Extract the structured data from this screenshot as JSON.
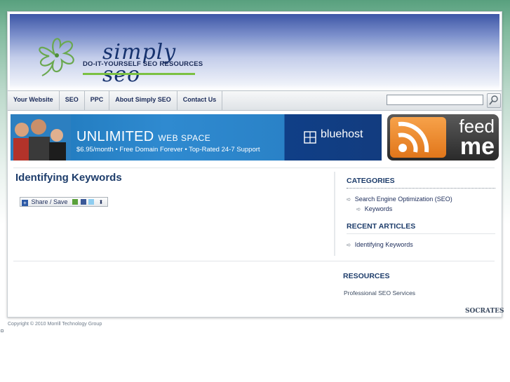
{
  "site": {
    "logo_title": "simply seo",
    "logo_subtitle": "DO-IT-YOURSELF SEO RESOURCES"
  },
  "nav": {
    "items": [
      {
        "label": "Your Website"
      },
      {
        "label": "SEO"
      },
      {
        "label": "PPC"
      },
      {
        "label": "About Simply SEO"
      },
      {
        "label": "Contact Us"
      }
    ],
    "search_value": ""
  },
  "banner": {
    "title_big": "UNLIMITED",
    "title_small": "WEB SPACE",
    "subtitle": "$6.95/month • Free Domain Forever • Top-Rated 24-7 Support",
    "brand": "bluehost"
  },
  "feed": {
    "line1": "feed",
    "line2": "me"
  },
  "post": {
    "title": "Identifying Keywords",
    "share_label": "Share / Save"
  },
  "sidebar": {
    "categories_title": "CATEGORIES",
    "categories": [
      {
        "label": "Search Engine Optimization (SEO)"
      },
      {
        "label": "Keywords"
      }
    ],
    "recent_title": "RECENT ARTICLES",
    "recent": [
      {
        "label": "Identifying Keywords"
      }
    ],
    "resources_title": "RESOURCES",
    "resources": [
      {
        "label": "Professional SEO Services"
      }
    ]
  },
  "footer": {
    "credit": "SOCRATES",
    "copyright": "Copyright © 2010 Morrill Technology Group"
  },
  "colors": {
    "accent_green": "#58a07e",
    "header_blue": "#3d56a6",
    "text_navy": "#1e3d6b"
  }
}
